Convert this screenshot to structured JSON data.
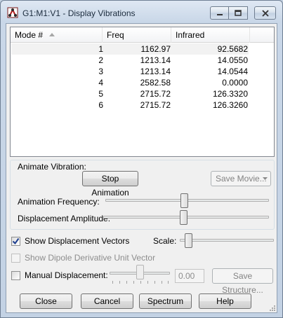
{
  "window": {
    "title": "G1:M1:V1 - Display Vibrations"
  },
  "list": {
    "columns": [
      "Mode #",
      "Freq",
      "Infrared"
    ],
    "rows": [
      {
        "mode": "1",
        "freq": "1162.97",
        "ir": "92.5682"
      },
      {
        "mode": "2",
        "freq": "1213.14",
        "ir": "14.0550"
      },
      {
        "mode": "3",
        "freq": "1213.14",
        "ir": "14.0544"
      },
      {
        "mode": "4",
        "freq": "2582.58",
        "ir": "0.0000"
      },
      {
        "mode": "5",
        "freq": "2715.72",
        "ir": "126.3320"
      },
      {
        "mode": "6",
        "freq": "2715.72",
        "ir": "126.3260"
      }
    ]
  },
  "animate": {
    "group_label": "Animate Vibration:",
    "stop_button": "Stop Animation",
    "save_movie": "Save Movie...",
    "frequency_label": "Animation Frequency:",
    "amplitude_label": "Displacement Amplitude:"
  },
  "options": {
    "show_vectors": "Show Displacement Vectors",
    "show_vectors_checked": true,
    "scale_label": "Scale:",
    "show_dipole": "Show Dipole Derivative Unit Vector",
    "manual_displacement": "Manual Displacement:",
    "manual_value": "0.00",
    "save_structure": "Save Structure..."
  },
  "footer": {
    "close": "Close",
    "cancel": "Cancel",
    "spectrum": "Spectrum",
    "help": "Help"
  },
  "colors": {
    "title_bg": "#c9d7e8",
    "client_bg": "#f0f0f0",
    "check_mark": "#1d3e8f"
  }
}
